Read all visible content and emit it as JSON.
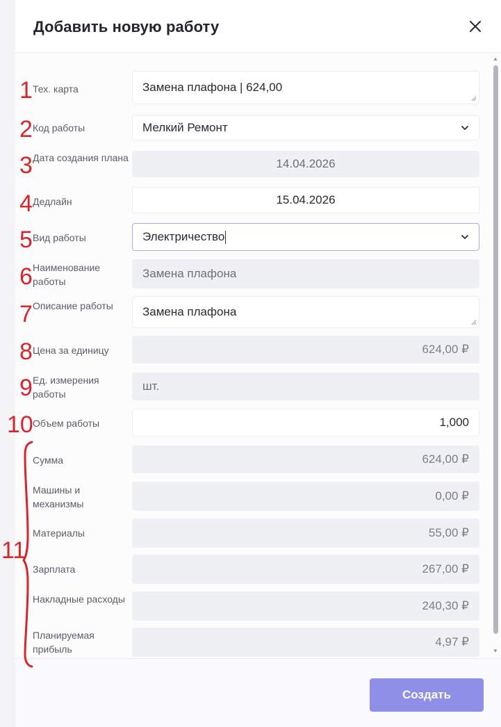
{
  "modal": {
    "title": "Добавить новую работу",
    "create_label": "Создать"
  },
  "fields": [
    {
      "number": "1",
      "label": "Тех. карта",
      "value": "Замена плафона | 624,00"
    },
    {
      "number": "2",
      "label": "Код работы",
      "value": "Мелкий Ремонт"
    },
    {
      "number": "3",
      "label": "Дата создания плана",
      "value": "14.04.2026"
    },
    {
      "number": "4",
      "label": "Дедлайн",
      "value": "15.04.2026"
    },
    {
      "number": "5",
      "label": "Вид работы",
      "value": "Электричество"
    },
    {
      "number": "6",
      "label": "Наименование работы",
      "value": "Замена плафона"
    },
    {
      "number": "7",
      "label": "Описание работы",
      "value": "Замена плафона"
    },
    {
      "number": "8",
      "label": "Цена за единицу",
      "value": "624,00 ₽"
    },
    {
      "number": "9",
      "label": "Ед. измерения работы",
      "value": "шт."
    },
    {
      "number": "10",
      "label": "Объем работы",
      "value": "1,000"
    }
  ],
  "costs": {
    "number": "11",
    "items": [
      {
        "label": "Сумма",
        "value": "624,00 ₽"
      },
      {
        "label": "Машины и механизмы",
        "value": "0,00 ₽"
      },
      {
        "label": "Материалы",
        "value": "55,00 ₽"
      },
      {
        "label": "Зарплата",
        "value": "267,00 ₽"
      },
      {
        "label": "Накладные расходы",
        "value": "240,30 ₽"
      },
      {
        "label": "Планируемая прибыль",
        "value": "4,97 ₽"
      }
    ]
  },
  "colors": {
    "accent": "#8f8fe8",
    "annotation": "#d6262c",
    "readonly_bg": "#eef0f3"
  },
  "icons": [
    "close-icon",
    "chevron-down-icon",
    "resize-handle-icon"
  ]
}
